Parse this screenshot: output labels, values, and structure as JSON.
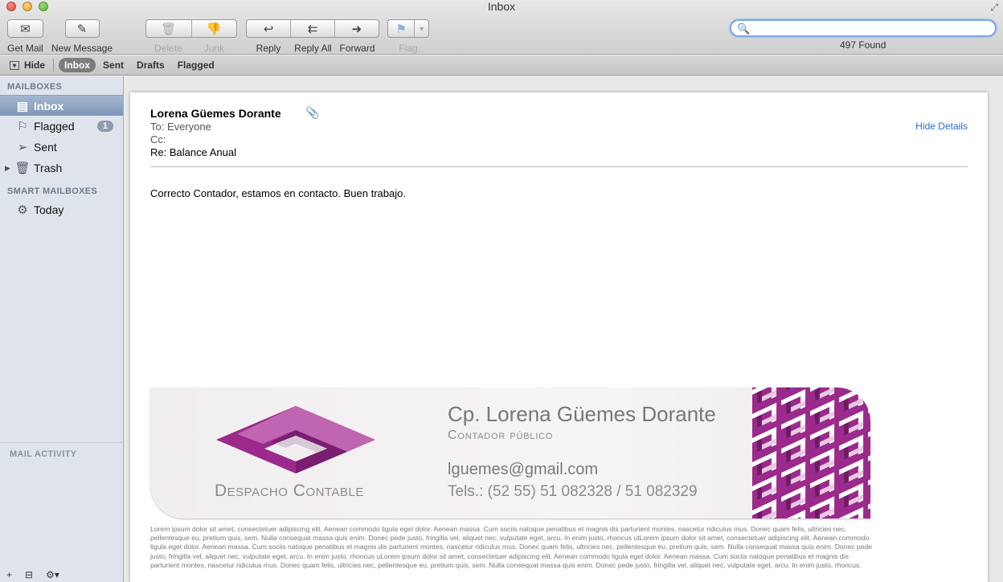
{
  "window": {
    "title": "Inbox"
  },
  "toolbar": {
    "get_mail": "Get Mail",
    "new_message": "New Message",
    "delete": "Delete",
    "junk": "Junk",
    "reply": "Reply",
    "reply_all": "Reply All",
    "forward": "Forward",
    "flag": "Flag"
  },
  "search": {
    "value": "",
    "found": "497 Found"
  },
  "favorites": {
    "hide": "Hide",
    "items": [
      "Inbox",
      "Sent",
      "Drafts",
      "Flagged"
    ]
  },
  "sidebar": {
    "mailboxes_heading": "MAILBOXES",
    "items": [
      {
        "label": "Inbox",
        "icon": "inbox-icon",
        "selected": true
      },
      {
        "label": "Flagged",
        "icon": "flag-icon",
        "badge": "1"
      },
      {
        "label": "Sent",
        "icon": "paper-plane-icon"
      },
      {
        "label": "Trash",
        "icon": "trash-icon"
      }
    ],
    "smart_heading": "SMART MAILBOXES",
    "smart_items": [
      {
        "label": "Today",
        "icon": "gear-icon"
      }
    ],
    "activity_heading": "MAIL ACTIVITY"
  },
  "message": {
    "from": "Lorena Güemes Dorante",
    "to": "To: Everyone",
    "cc": "Cc:",
    "subject": "Re: Balance Anual",
    "hide_details": "Hide Details",
    "body": "Correcto Contador, estamos en contacto. Buen trabajo."
  },
  "signature": {
    "brand_word1": "Despacho",
    "brand_word2": "Contable",
    "name": "Cp. Lorena Güemes Dorante",
    "role_word1": "Contador",
    "role_word2": "público",
    "email": "lguemes@gmail.com",
    "phone": "Tels.: (52 55) 51 082328 / 51 082329",
    "accent_color": "#9b2a8c",
    "lorem": "Lorem ipsum dolor sit amet, consectetuer adipiscing elit. Aenean commodo ligula eget dolor. Aenean massa. Cum sociis natoque penatibus et magnis dis parturient montes, nascetur ridiculus mus. Donec quam felis, ultricies nec, pellentesque eu, pretium quis, sem. Nulla consequat massa quis enim. Donec pede justo, fringilla vel, aliquet nec, vulputate eget, arcu. In enim justo, rhoncus utLorem ipsum dolor sit amet, consectetuer adipiscing elit. Aenean commodo ligula eget dolor. Aenean massa. Cum sociis natoque penatibus et magnis dis parturient montes, nascetur ridiculus mus. Donec quam felis, ultricies nec, pellentesque eu, pretium quis, sem. Nulla consequat massa quis enim. Donec pede justo, fringilla vel, aliquet nec, vulputate eget, arcu. In enim justo, rhoncus uLorem ipsum dolor sit amet, consectetuer adipiscing elit. Aenean commodo ligula eget dolor. Aenean massa. Cum sociis natoque penatibus et magnis dis parturient montes, nascetur ridiculus mus. Donec quam felis, ultricies nec, pellentesque eu, pretium quis, sem. Nulla consequat massa quis enim. Donec pede justo, fringilla vel, aliquet nec, vulputate eget, arcu. In enim justo, rhoncus."
  }
}
